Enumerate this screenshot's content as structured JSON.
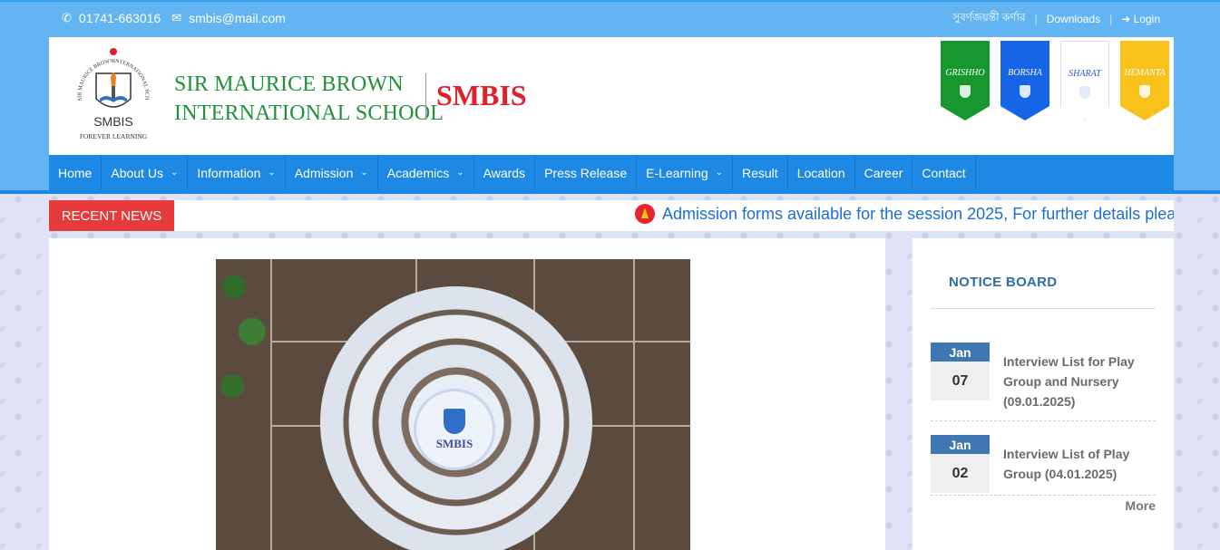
{
  "topbar": {
    "phone_icon": "phone-icon",
    "phone": "01741-663016",
    "email_icon": "envelope-icon",
    "email": "smbis@mail.com",
    "links": {
      "bangla": "সুবর্ণজয়ন্তী কর্ণার",
      "downloads": "Downloads",
      "login_icon": "sign-in-icon",
      "login": "Login"
    }
  },
  "header": {
    "logo": {
      "top_arc_left": "SIR MAURICE BROWN",
      "top_arc_right": "INTERNATIONAL SCHOOL",
      "wordmark": "SMBIS",
      "tagline": "FOREVER LEARNING"
    },
    "school_line1": "SIR MAURICE BROWN",
    "school_line2": "INTERNATIONAL SCHOOL",
    "short_name": "SMBIS",
    "houses": [
      "GRISHHO",
      "BORSHA",
      "SHARAT",
      "HEMANTA"
    ]
  },
  "nav": {
    "items": [
      {
        "label": "Home",
        "dropdown": false
      },
      {
        "label": "About Us",
        "dropdown": true
      },
      {
        "label": "Information",
        "dropdown": true
      },
      {
        "label": "Admission",
        "dropdown": true
      },
      {
        "label": "Academics",
        "dropdown": true
      },
      {
        "label": "Awards",
        "dropdown": false
      },
      {
        "label": "Press Release",
        "dropdown": false
      },
      {
        "label": "E-Learning",
        "dropdown": true
      },
      {
        "label": "Result",
        "dropdown": false
      },
      {
        "label": "Location",
        "dropdown": false
      },
      {
        "label": "Career",
        "dropdown": false
      },
      {
        "label": "Contact",
        "dropdown": false
      }
    ]
  },
  "news": {
    "label": "RECENT NEWS",
    "ticker": "Admission forms available for the session 2025, For further details plea"
  },
  "main": {
    "photo_emblem_text": "SMBIS"
  },
  "notice_board": {
    "title": "NOTICE BOARD",
    "items": [
      {
        "month": "Jan",
        "day": "07",
        "text": "Interview List for Play Group and Nursery (09.01.2025)"
      },
      {
        "month": "Jan",
        "day": "02",
        "text": "Interview List of Play Group (04.01.2025)"
      }
    ],
    "more": "More"
  },
  "colors": {
    "topbar": "#62b4f2",
    "nav": "#1e88e5",
    "news_label": "#e83a3a",
    "school_green": "#22913b",
    "smbis_red": "#e0212b",
    "notice_month": "#3e77b1"
  }
}
